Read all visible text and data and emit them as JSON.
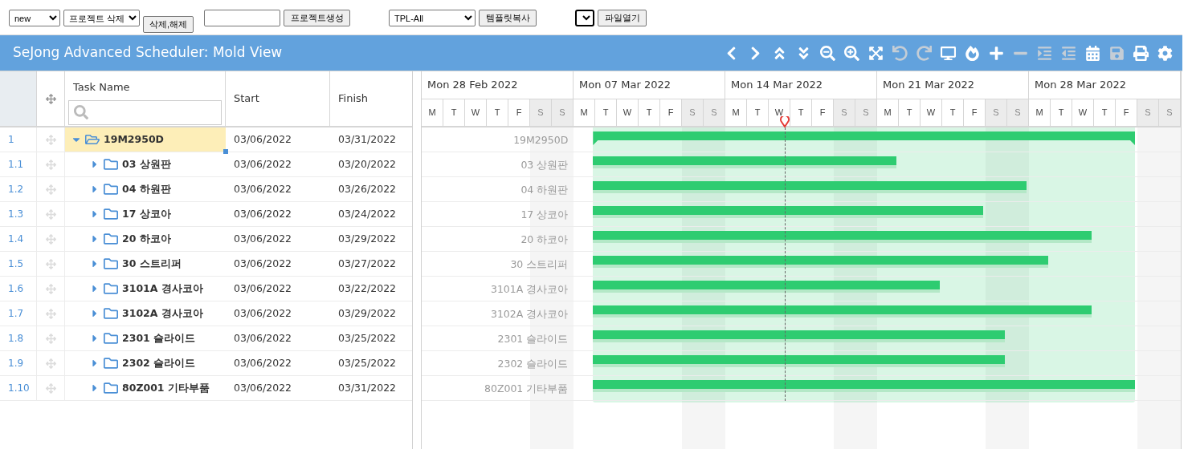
{
  "toolbar": {
    "items": [
      {
        "kind": "select",
        "value": "new",
        "focused": false
      },
      {
        "kind": "select",
        "value": "프로젝트 삭제",
        "focused": false
      },
      {
        "kind": "button",
        "label": "삭제,해제"
      },
      {
        "kind": "input"
      },
      {
        "kind": "button",
        "label": "프로젝트생성"
      },
      {
        "kind": "select",
        "value": "TPL-All",
        "focused": false
      },
      {
        "kind": "button",
        "label": "템플릿복사"
      },
      {
        "kind": "select",
        "focused": true
      },
      {
        "kind": "button",
        "label": "파일열기"
      }
    ]
  },
  "header": {
    "title": "SeJong Advanced Scheduler: Mold View",
    "tools": [
      {
        "disabled": false
      },
      {
        "disabled": false
      },
      {
        "disabled": false
      },
      {
        "disabled": false
      },
      {
        "disabled": false
      },
      {
        "disabled": false
      },
      {
        "disabled": false
      },
      {
        "disabled": true
      },
      {
        "disabled": true
      },
      {
        "disabled": false
      },
      {
        "disabled": false
      },
      {
        "disabled": false
      },
      {
        "disabled": true
      },
      {
        "disabled": true
      },
      {
        "disabled": true
      },
      {
        "disabled": false
      },
      {
        "disabled": true
      },
      {
        "disabled": false
      },
      {
        "disabled": false
      }
    ]
  },
  "grid": {
    "columns": [
      "Task Name",
      "Start",
      "Finish"
    ],
    "rows": [
      {
        "num": "1",
        "name": "19M2950D",
        "start": "03/06/2022",
        "finish": "03/31/2022",
        "bar_label": "19M2950D",
        "expanded": true,
        "selected": true,
        "children": [
          {
            "num": "1.1",
            "name": "03 상원판",
            "start": "03/06/2022",
            "finish": "03/20/2022",
            "bar_label": "03 상원판",
            "expanded": false,
            "selected": false
          },
          {
            "num": "1.2",
            "name": "04 하원판",
            "start": "03/06/2022",
            "finish": "03/26/2022",
            "bar_label": "04 하원판",
            "expanded": false,
            "selected": false
          },
          {
            "num": "1.3",
            "name": "17 상코아",
            "start": "03/06/2022",
            "finish": "03/24/2022",
            "bar_label": "17 상코아",
            "expanded": false,
            "selected": false
          },
          {
            "num": "1.4",
            "name": "20 하코아",
            "start": "03/06/2022",
            "finish": "03/29/2022",
            "bar_label": "20 하코아",
            "expanded": false,
            "selected": false
          },
          {
            "num": "1.5",
            "name": "30 스트리퍼",
            "start": "03/06/2022",
            "finish": "03/27/2022",
            "bar_label": "30 스트리퍼",
            "expanded": false,
            "selected": false
          },
          {
            "num": "1.6",
            "name": "3101A 경사코아",
            "start": "03/06/2022",
            "finish": "03/22/2022",
            "bar_label": "3101A 경사코아",
            "expanded": false,
            "selected": false
          },
          {
            "num": "1.7",
            "name": "3102A 경사코아",
            "start": "03/06/2022",
            "finish": "03/29/2022",
            "bar_label": "3102A 경사코아",
            "expanded": false,
            "selected": false
          },
          {
            "num": "1.8",
            "name": "2301 슬라이드",
            "start": "03/06/2022",
            "finish": "03/25/2022",
            "bar_label": "2301 슬라이드",
            "expanded": false,
            "selected": false
          },
          {
            "num": "1.9",
            "name": "2302 슬라이드",
            "start": "03/06/2022",
            "finish": "03/25/2022",
            "bar_label": "2302 슬라이드",
            "expanded": false,
            "selected": false
          },
          {
            "num": "1.10",
            "name": "80Z001 기타부품",
            "start": "03/06/2022",
            "finish": "03/31/2022",
            "bar_label": "80Z001 기타부품",
            "expanded": false,
            "selected": false
          }
        ]
      }
    ]
  },
  "gantt": {
    "weeks": [
      "Mon 28 Feb 2022",
      "Mon 07 Mar 2022",
      "Mon 14 Mar 2022",
      "Mon 21 Mar 2022",
      "Mon 28 Mar 2022"
    ],
    "days": [
      {
        "label": "M",
        "weekend": false
      },
      {
        "label": "T",
        "weekend": false
      },
      {
        "label": "W",
        "weekend": false
      },
      {
        "label": "T",
        "weekend": false
      },
      {
        "label": "F",
        "weekend": false
      },
      {
        "label": "S",
        "weekend": true
      },
      {
        "label": "S",
        "weekend": true
      },
      {
        "label": "M",
        "weekend": false
      },
      {
        "label": "T",
        "weekend": false
      },
      {
        "label": "W",
        "weekend": false
      },
      {
        "label": "T",
        "weekend": false
      },
      {
        "label": "F",
        "weekend": false
      },
      {
        "label": "S",
        "weekend": true
      },
      {
        "label": "S",
        "weekend": true
      },
      {
        "label": "M",
        "weekend": false
      },
      {
        "label": "T",
        "weekend": false
      },
      {
        "label": "W",
        "weekend": false
      },
      {
        "label": "T",
        "weekend": false
      },
      {
        "label": "F",
        "weekend": false
      },
      {
        "label": "S",
        "weekend": true
      },
      {
        "label": "S",
        "weekend": true
      },
      {
        "label": "M",
        "weekend": false
      },
      {
        "label": "T",
        "weekend": false
      },
      {
        "label": "W",
        "weekend": false
      },
      {
        "label": "T",
        "weekend": false
      },
      {
        "label": "F",
        "weekend": false
      },
      {
        "label": "S",
        "weekend": true
      },
      {
        "label": "S",
        "weekend": true
      },
      {
        "label": "M",
        "weekend": false
      },
      {
        "label": "T",
        "weekend": false
      },
      {
        "label": "W",
        "weekend": false
      },
      {
        "label": "T",
        "weekend": false
      },
      {
        "label": "F",
        "weekend": false
      },
      {
        "label": "S",
        "weekend": true
      },
      {
        "label": "S",
        "weekend": true
      }
    ]
  }
}
